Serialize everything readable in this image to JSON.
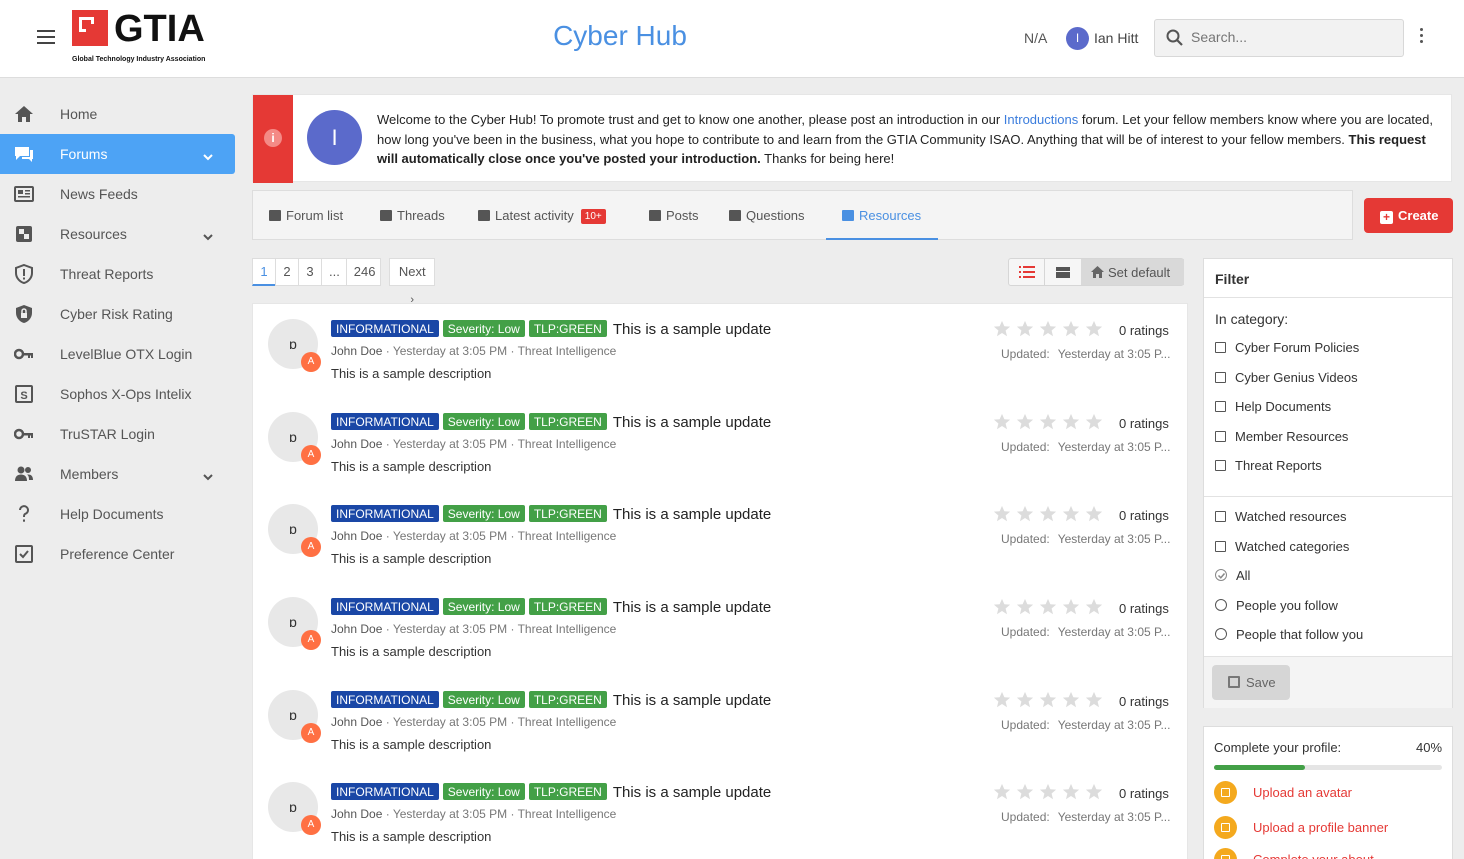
{
  "header": {
    "logo_word": "GTIA",
    "logo_sub": "Global Technology Industry Association",
    "site_title": "Cyber Hub",
    "na_label": "N/A",
    "user_initial": "I",
    "user_name": "Ian Hitt",
    "search_placeholder": "Search..."
  },
  "sidebar": {
    "items": [
      {
        "label": "Home",
        "icon": "home-icon"
      },
      {
        "label": "Forums",
        "icon": "chat-icon",
        "active": true,
        "expandable": true
      },
      {
        "label": "News Feeds",
        "icon": "newspaper-icon"
      },
      {
        "label": "Resources",
        "icon": "resources-icon",
        "expandable": true
      },
      {
        "label": "Threat Reports",
        "icon": "shield-alert-icon"
      },
      {
        "label": "Cyber Risk Rating",
        "icon": "shield-lock-icon"
      },
      {
        "label": "LevelBlue OTX Login",
        "icon": "key-icon"
      },
      {
        "label": "Sophos X-Ops Intelix",
        "icon": "sophos-icon"
      },
      {
        "label": "TruSTAR Login",
        "icon": "key-icon"
      },
      {
        "label": "Members",
        "icon": "members-icon",
        "expandable": true
      },
      {
        "label": "Help Documents",
        "icon": "question-icon"
      },
      {
        "label": "Preference Center",
        "icon": "checkbox-icon"
      }
    ]
  },
  "notice": {
    "avatar_initial": "I",
    "text_1": "Welcome to the Cyber Hub! To promote trust and get to know one another, please post an introduction in our ",
    "link": "Introductions",
    "text_2": " forum. Let your fellow members know where you are located, how long you've been in the business, what you hope to contribute to and learn from the GTIA Community ISAO. Anything that will be of interest to your fellow members. ",
    "bold": "This request will automatically close once you've posted your introduction.",
    "text_3": " Thanks for being here!"
  },
  "tabs": [
    {
      "label": "Forum list"
    },
    {
      "label": "Threads"
    },
    {
      "label": "Latest activity",
      "badge": "10+"
    },
    {
      "label": "Posts"
    },
    {
      "label": "Questions"
    },
    {
      "label": "Resources",
      "active": true
    }
  ],
  "create_label": "Create",
  "pagination": {
    "pages": [
      "1",
      "2",
      "3",
      "...",
      "246"
    ],
    "current": "1",
    "next": "Next"
  },
  "view": {
    "set_default": "Set default"
  },
  "resources": [
    {
      "avatar": "ɒ",
      "badge": "A",
      "tags": [
        "INFORMATIONAL",
        "Severity: Low",
        "TLP:GREEN"
      ],
      "title": "This is a sample update",
      "author": "John Doe",
      "time": "Yesterday at 3:05 PM",
      "category": "Threat Intelligence",
      "description": "This is a sample description",
      "ratings": "0 ratings",
      "updated_label": "Updated:",
      "updated": "Yesterday at 3:05 P..."
    },
    {
      "avatar": "ɒ",
      "badge": "A",
      "tags": [
        "INFORMATIONAL",
        "Severity: Low",
        "TLP:GREEN"
      ],
      "title": "This is a sample update",
      "author": "John Doe",
      "time": "Yesterday at 3:05 PM",
      "category": "Threat Intelligence",
      "description": "This is a sample description",
      "ratings": "0 ratings",
      "updated_label": "Updated:",
      "updated": "Yesterday at 3:05 P..."
    },
    {
      "avatar": "ɒ",
      "badge": "A",
      "tags": [
        "INFORMATIONAL",
        "Severity: Low",
        "TLP:GREEN"
      ],
      "title": "This is a sample update",
      "author": "John Doe",
      "time": "Yesterday at 3:05 PM",
      "category": "Threat Intelligence",
      "description": "This is a sample description",
      "ratings": "0 ratings",
      "updated_label": "Updated:",
      "updated": "Yesterday at 3:05 P..."
    },
    {
      "avatar": "ɒ",
      "badge": "A",
      "tags": [
        "INFORMATIONAL",
        "Severity: Low",
        "TLP:GREEN"
      ],
      "title": "This is a sample update",
      "author": "John Doe",
      "time": "Yesterday at 3:05 PM",
      "category": "Threat Intelligence",
      "description": "This is a sample description",
      "ratings": "0 ratings",
      "updated_label": "Updated:",
      "updated": "Yesterday at 3:05 P..."
    },
    {
      "avatar": "ɒ",
      "badge": "A",
      "tags": [
        "INFORMATIONAL",
        "Severity: Low",
        "TLP:GREEN"
      ],
      "title": "This is a sample update",
      "author": "John Doe",
      "time": "Yesterday at 3:05 PM",
      "category": "Threat Intelligence",
      "description": "This is a sample description",
      "ratings": "0 ratings",
      "updated_label": "Updated:",
      "updated": "Yesterday at 3:05 P..."
    },
    {
      "avatar": "ɒ",
      "badge": "A",
      "tags": [
        "INFORMATIONAL",
        "Severity: Low",
        "TLP:GREEN"
      ],
      "title": "This is a sample update",
      "author": "John Doe",
      "time": "Yesterday at 3:05 PM",
      "category": "Threat Intelligence",
      "description": "This is a sample description",
      "ratings": "0 ratings",
      "updated_label": "Updated:",
      "updated": "Yesterday at 3:05 P..."
    }
  ],
  "filter": {
    "title": "Filter",
    "category_label": "In category:",
    "categories": [
      "Cyber Forum Policies",
      "Cyber Genius Videos",
      "Help Documents",
      "Member Resources",
      "Threat Reports"
    ],
    "watched": [
      "Watched resources",
      "Watched categories"
    ],
    "follow": [
      {
        "label": "All",
        "checked": true
      },
      {
        "label": "People you follow"
      },
      {
        "label": "People that follow you"
      }
    ],
    "save_label": "Save"
  },
  "profile": {
    "caption": "Complete your profile:",
    "percent_label": "40%",
    "percent": 40,
    "items": [
      "Upload an avatar",
      "Upload a profile banner",
      "Complete your about"
    ]
  },
  "colors": {
    "accent": "#4a90e2",
    "brand_red": "#e53935",
    "tag_blue": "#1a47a6",
    "tag_green": "#43a047",
    "sidebar_active": "#4da3f5"
  }
}
